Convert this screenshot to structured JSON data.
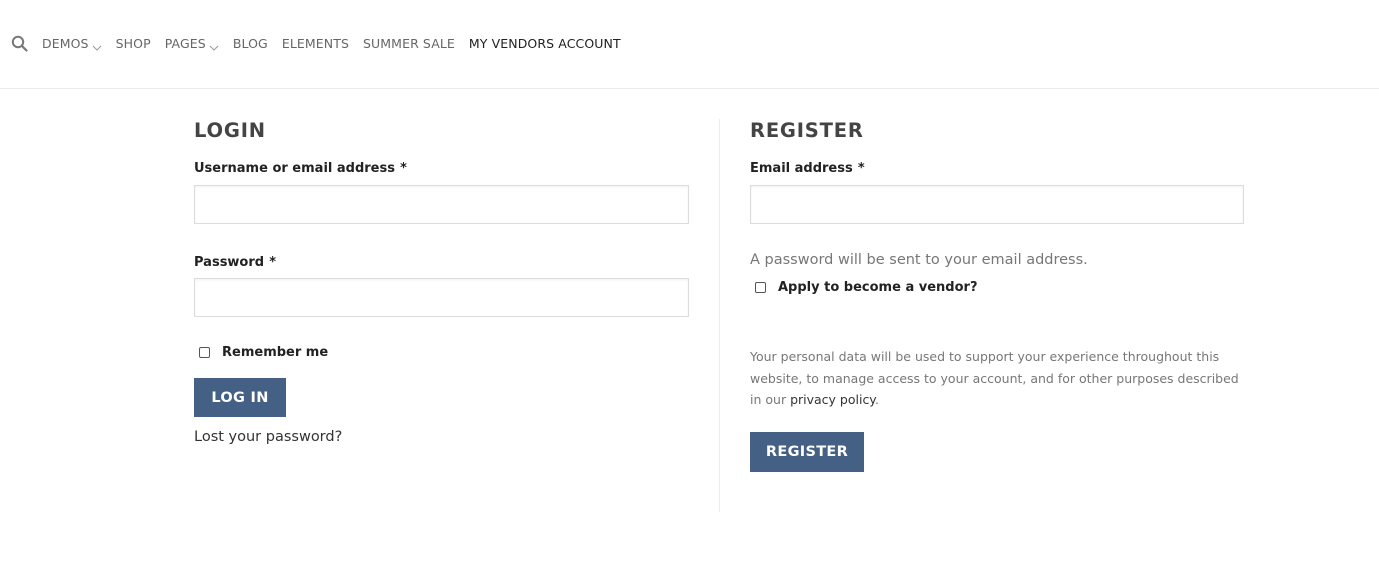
{
  "nav": {
    "items": [
      {
        "label": "DEMOS",
        "has_dropdown": true
      },
      {
        "label": "SHOP",
        "has_dropdown": false
      },
      {
        "label": "PAGES",
        "has_dropdown": true
      },
      {
        "label": "BLOG",
        "has_dropdown": false
      },
      {
        "label": "ELEMENTS",
        "has_dropdown": false
      },
      {
        "label": "SUMMER SALE",
        "has_dropdown": false
      },
      {
        "label": "MY VENDORS ACCOUNT",
        "has_dropdown": false,
        "active": true
      }
    ]
  },
  "login": {
    "title": "LOGIN",
    "username_label": "Username or email address",
    "username_value": "",
    "password_label": "Password",
    "password_value": "",
    "required_mark": "*",
    "remember_label": "Remember me",
    "remember_checked": false,
    "button_label": "LOG IN",
    "lost_password": "Lost your password?"
  },
  "register": {
    "title": "REGISTER",
    "email_label": "Email address",
    "email_value": "",
    "required_mark": "*",
    "password_info": "A password will be sent to your email address.",
    "vendor_label": "Apply to become a vendor?",
    "vendor_checked": false,
    "privacy_text": "Your personal data will be used to support your experience throughout this website, to manage access to your account, and for other purposes described in our",
    "privacy_link": "privacy policy",
    "privacy_end": ".",
    "button_label": "REGISTER"
  },
  "colors": {
    "button": "#446084",
    "nav_text": "#666666",
    "nav_active": "#222222"
  },
  "icons": {
    "search": "search-icon",
    "dropdown": "chevron-down-icon"
  }
}
